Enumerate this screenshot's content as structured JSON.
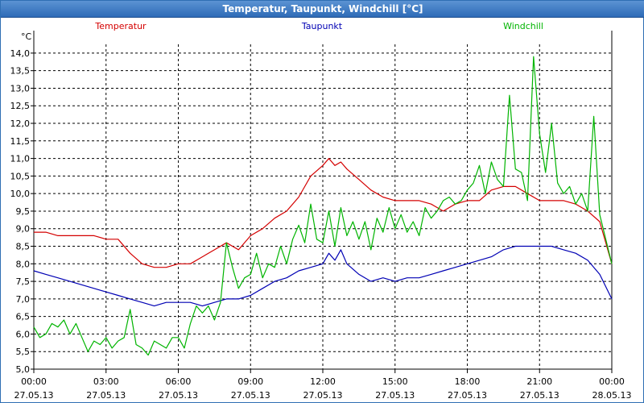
{
  "window": {
    "title": "Temperatur, Taupunkt, Windchill [°C]"
  },
  "chart_data": {
    "type": "line",
    "title": "Temperatur, Taupunkt, Windchill [°C]",
    "ylabel": "°C",
    "ylim": [
      5.0,
      14.25
    ],
    "xlim_hours": [
      0,
      24
    ],
    "grid": true,
    "legend_placement": "top",
    "y_ticks": [
      "5,0",
      "5,5",
      "6,0",
      "6,5",
      "7,0",
      "7,5",
      "8,0",
      "8,5",
      "9,0",
      "9,5",
      "10,0",
      "10,5",
      "11,0",
      "11,5",
      "12,0",
      "12,5",
      "13,0",
      "13,5",
      "14,0"
    ],
    "x_ticks": [
      {
        "time": "00:00",
        "date": "27.05.13"
      },
      {
        "time": "03:00",
        "date": "27.05.13"
      },
      {
        "time": "06:00",
        "date": "27.05.13"
      },
      {
        "time": "09:00",
        "date": "27.05.13"
      },
      {
        "time": "12:00",
        "date": "27.05.13"
      },
      {
        "time": "15:00",
        "date": "27.05.13"
      },
      {
        "time": "18:00",
        "date": "27.05.13"
      },
      {
        "time": "21:00",
        "date": "27.05.13"
      },
      {
        "time": "00:00",
        "date": "28.05.13"
      }
    ],
    "series": [
      {
        "name": "Temperatur",
        "color": "#d40000",
        "x": [
          0,
          0.5,
          1,
          1.5,
          2,
          2.5,
          3,
          3.5,
          4,
          4.5,
          5,
          5.5,
          6,
          6.5,
          7,
          7.5,
          8,
          8.5,
          9,
          9.5,
          10,
          10.5,
          11,
          11.5,
          12,
          12.25,
          12.5,
          12.75,
          13,
          13.5,
          14,
          14.5,
          15,
          15.5,
          16,
          16.5,
          17,
          17.5,
          18,
          18.5,
          19,
          19.5,
          20,
          20.5,
          21,
          21.5,
          22,
          22.5,
          23,
          23.5,
          24
        ],
        "values": [
          8.9,
          8.9,
          8.8,
          8.8,
          8.8,
          8.8,
          8.7,
          8.7,
          8.3,
          8.0,
          7.9,
          7.9,
          8.0,
          8.0,
          8.2,
          8.4,
          8.6,
          8.4,
          8.8,
          9.0,
          9.3,
          9.5,
          9.9,
          10.5,
          10.8,
          11.0,
          10.8,
          10.9,
          10.7,
          10.4,
          10.1,
          9.9,
          9.8,
          9.8,
          9.8,
          9.7,
          9.5,
          9.7,
          9.8,
          9.8,
          10.1,
          10.2,
          10.2,
          10.0,
          9.8,
          9.8,
          9.8,
          9.7,
          9.5,
          9.2,
          8.0
        ]
      },
      {
        "name": "Taupunkt",
        "color": "#0000b4",
        "x": [
          0,
          0.5,
          1,
          1.5,
          2,
          2.5,
          3,
          3.5,
          4,
          4.5,
          5,
          5.5,
          6,
          6.5,
          7,
          7.5,
          8,
          8.5,
          9,
          9.5,
          10,
          10.5,
          11,
          11.5,
          12,
          12.25,
          12.5,
          12.75,
          13,
          13.5,
          14,
          14.5,
          15,
          15.5,
          16,
          16.5,
          17,
          17.5,
          18,
          18.5,
          19,
          19.5,
          20,
          20.5,
          21,
          21.5,
          22,
          22.5,
          23,
          23.5,
          24
        ],
        "values": [
          7.8,
          7.7,
          7.6,
          7.5,
          7.4,
          7.3,
          7.2,
          7.1,
          7.0,
          6.9,
          6.8,
          6.9,
          6.9,
          6.9,
          6.8,
          6.9,
          7.0,
          7.0,
          7.1,
          7.3,
          7.5,
          7.6,
          7.8,
          7.9,
          8.0,
          8.3,
          8.1,
          8.4,
          8.0,
          7.7,
          7.5,
          7.6,
          7.5,
          7.6,
          7.6,
          7.7,
          7.8,
          7.9,
          8.0,
          8.1,
          8.2,
          8.4,
          8.5,
          8.5,
          8.5,
          8.5,
          8.4,
          8.3,
          8.1,
          7.7,
          7.0
        ]
      },
      {
        "name": "Windchill",
        "color": "#00b400",
        "x": [
          0,
          0.25,
          0.5,
          0.75,
          1,
          1.25,
          1.5,
          1.75,
          2,
          2.25,
          2.5,
          2.75,
          3,
          3.25,
          3.5,
          3.75,
          4,
          4.25,
          4.5,
          4.75,
          5,
          5.25,
          5.5,
          5.75,
          6,
          6.25,
          6.5,
          6.75,
          7,
          7.25,
          7.5,
          7.75,
          8,
          8.25,
          8.5,
          8.75,
          9,
          9.25,
          9.5,
          9.75,
          10,
          10.25,
          10.5,
          10.75,
          11,
          11.25,
          11.5,
          11.75,
          12,
          12.25,
          12.5,
          12.75,
          13,
          13.25,
          13.5,
          13.75,
          14,
          14.25,
          14.5,
          14.75,
          15,
          15.25,
          15.5,
          15.75,
          16,
          16.25,
          16.5,
          16.75,
          17,
          17.25,
          17.5,
          17.75,
          18,
          18.25,
          18.5,
          18.75,
          19,
          19.25,
          19.5,
          19.75,
          20,
          20.25,
          20.5,
          20.75,
          21,
          21.25,
          21.5,
          21.75,
          22,
          22.25,
          22.5,
          22.75,
          23,
          23.25,
          23.5,
          23.75,
          24
        ],
        "values": [
          6.2,
          5.9,
          6.0,
          6.3,
          6.2,
          6.4,
          6.0,
          6.3,
          5.9,
          5.5,
          5.8,
          5.7,
          5.9,
          5.6,
          5.8,
          5.9,
          6.7,
          5.7,
          5.6,
          5.4,
          5.8,
          5.7,
          5.6,
          5.9,
          5.9,
          5.6,
          6.3,
          6.8,
          6.6,
          6.8,
          6.4,
          6.9,
          8.6,
          7.9,
          7.3,
          7.6,
          7.7,
          8.3,
          7.6,
          8.0,
          7.9,
          8.5,
          8.0,
          8.7,
          9.1,
          8.6,
          9.7,
          8.7,
          8.6,
          9.5,
          8.5,
          9.6,
          8.8,
          9.2,
          8.7,
          9.2,
          8.4,
          9.3,
          8.9,
          9.6,
          9.0,
          9.4,
          8.9,
          9.2,
          8.8,
          9.6,
          9.3,
          9.5,
          9.8,
          9.9,
          9.7,
          9.8,
          10.1,
          10.3,
          10.8,
          10.0,
          10.9,
          10.4,
          10.2,
          12.8,
          10.7,
          10.6,
          9.8,
          13.9,
          11.7,
          10.6,
          12.0,
          10.3,
          10.0,
          10.2,
          9.7,
          10.0,
          9.5,
          12.2,
          9.4,
          8.7,
          8.0
        ]
      }
    ]
  }
}
